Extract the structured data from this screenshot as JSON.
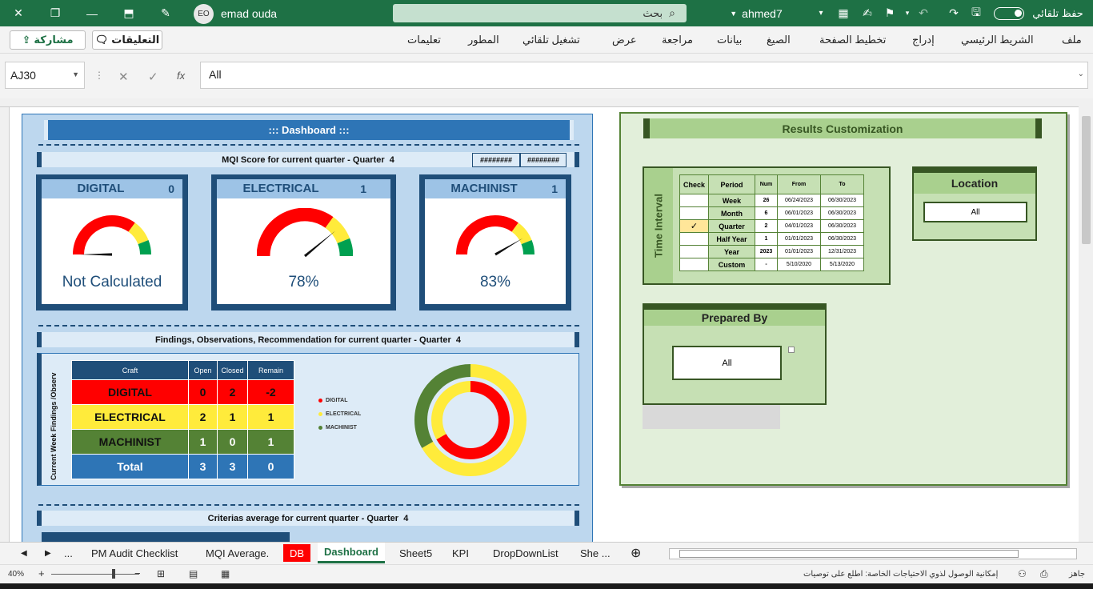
{
  "titlebar": {
    "autosave": "حفظ تلقائي",
    "file_account": "ahmed7",
    "search_placeholder": "بحث",
    "user_name": "emad ouda",
    "user_initials": "EO"
  },
  "ribbon": {
    "tabs": [
      "ملف",
      "الشريط الرئيسي",
      "إدراج",
      "تخطيط الصفحة",
      "الصيغ",
      "بيانات",
      "مراجعة",
      "عرض",
      "تشغيل تلقائي",
      "المطور",
      "تعليمات"
    ],
    "comments_label": "التعليقات",
    "share_label": "مشاركة"
  },
  "formula_bar": {
    "name_box": "AJ30",
    "formula": "All"
  },
  "dashboard": {
    "title": "::: Dashboard :::",
    "mqi_title": "MQI Score for current quarter - Quarter",
    "mqi_quarter": "4",
    "hash1": "########",
    "hash2": "########",
    "gauges": [
      {
        "name": "DIGITAL",
        "count": "0",
        "value": "Not Calculated",
        "score": 0
      },
      {
        "name": "ELECTRICAL",
        "count": "1",
        "value": "78%",
        "score": 0.78
      },
      {
        "name": "MACHINIST",
        "count": "1",
        "value": "83%",
        "score": 0.83
      }
    ],
    "findings_title": "Findings, Observations, Recommendation for current quarter - Quarter",
    "findings_quarter": "4",
    "findings_vlabel": "Current Week Findings /Observ",
    "findings_headers": [
      "Craft",
      "Open",
      "Closed",
      "Remain"
    ],
    "findings_rows": [
      {
        "craft": "DIGITAL",
        "open": "0",
        "closed": "2",
        "remain": "-2",
        "color": "#ff0000"
      },
      {
        "craft": "ELECTRICAL",
        "open": "2",
        "closed": "1",
        "remain": "1",
        "color": "#ffeb3b"
      },
      {
        "craft": "MACHINIST",
        "open": "1",
        "closed": "0",
        "remain": "1",
        "color": "#548235"
      },
      {
        "craft": "Total",
        "open": "3",
        "closed": "3",
        "remain": "0",
        "color": "#2e75b6"
      }
    ],
    "legend": [
      "DIGITAL",
      "ELECTRICAL",
      "MACHINIST"
    ],
    "criterias_title": "Criterias average for current quarter - Quarter",
    "criterias_quarter": "4"
  },
  "chart_data": {
    "type": "pie",
    "subtype": "doughnut",
    "categories": [
      "DIGITAL",
      "ELECTRICAL",
      "MACHINIST"
    ],
    "series": [
      {
        "values": [
          0,
          2,
          1
        ]
      },
      {
        "values": [
          2,
          1,
          0
        ]
      }
    ],
    "legend": "left"
  },
  "results": {
    "title": "Results Customization",
    "time_interval_label": "Time Interval",
    "period_headers": [
      "Check",
      "Period",
      "Num",
      "From",
      "To"
    ],
    "periods": [
      {
        "check": "",
        "period": "Week",
        "num": "26",
        "from": "06/24/2023",
        "to": "06/30/2023"
      },
      {
        "check": "",
        "period": "Month",
        "num": "6",
        "from": "06/01/2023",
        "to": "06/30/2023"
      },
      {
        "check": "✓",
        "period": "Quarter",
        "num": "2",
        "from": "04/01/2023",
        "to": "06/30/2023"
      },
      {
        "check": "",
        "period": "Half Year",
        "num": "1",
        "from": "01/01/2023",
        "to": "06/30/2023"
      },
      {
        "check": "",
        "period": "Year",
        "num": "2023",
        "from": "01/01/2023",
        "to": "12/31/2023"
      },
      {
        "check": "",
        "period": "Custom",
        "num": "-",
        "from": "5/10/2020",
        "to": "5/13/2020"
      }
    ],
    "location_label": "Location",
    "location_value": "All",
    "prepared_label": "Prepared By",
    "prepared_value": "All"
  },
  "sheet_tabs": [
    "...",
    "PM Audit Checklist",
    "MQI Average.",
    "DB",
    "Dashboard",
    "Sheet5",
    "KPI",
    "DropDownList",
    "She ..."
  ],
  "active_tab": "Dashboard",
  "status": {
    "zoom": "40%",
    "ready": "جاهز",
    "accessibility": "إمكانية الوصول لذوي الاحتياجات الخاصة: اطلع على توصيات"
  },
  "colors": {
    "excel_green": "#1e7145",
    "dash_blue": "#2e75b6",
    "dark_blue": "#1f4e79",
    "red": "#ff0000",
    "yellow": "#ffeb3b",
    "green": "#548235"
  }
}
